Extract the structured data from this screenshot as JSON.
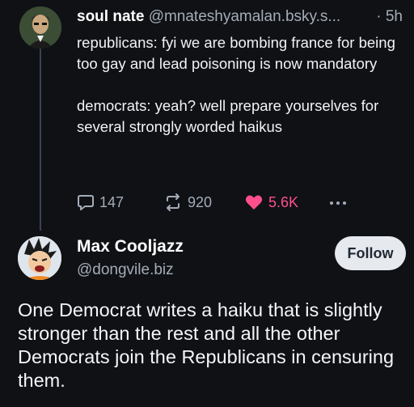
{
  "post1": {
    "author_name": "soul nate",
    "author_handle": "@mnateshyamalan.bsky.s...",
    "time": "· 5h",
    "text_paragraph1": "republicans: fyi we are bombing france for being too gay and lead poisoning is now mandatory",
    "text_paragraph2": "democrats: yeah? well prepare yourselves for several strongly worded haikus",
    "reply_count": "147",
    "repost_count": "920",
    "like_count": "5.6K",
    "icons": [
      "reply-icon",
      "repost-icon",
      "like-icon",
      "more-icon"
    ]
  },
  "post2": {
    "author_name": "Max Cooljazz",
    "author_handle": "@dongvile.biz",
    "follow_label": "Follow",
    "text": "One Democrat writes a haiku that is slightly stronger than the rest and all the other Democrats join the Republicans in censuring them."
  },
  "colors": {
    "background": "#0f1115",
    "muted_text": "#a4acb8",
    "like_pink": "#ff4f8b",
    "follow_button_bg": "#e6e9ee"
  }
}
